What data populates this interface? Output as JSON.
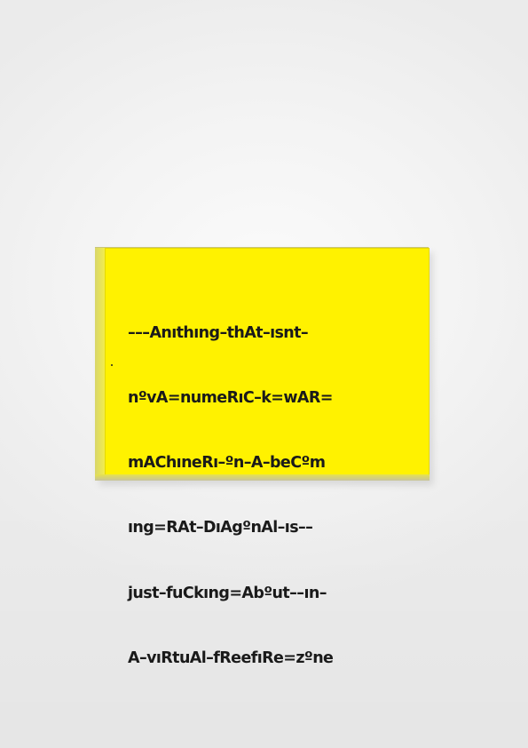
{
  "artwork": {
    "lines": [
      "–––Anıthıng–thAt–ısnt–",
      "nºvA=numeRıC–k=wAR=",
      "mAChıneRı–ºn–A–beCºm",
      "ıng=RAt–DıAgºnAl–ıs––",
      "just–fuCkıng=Abºut––ın–",
      "A–vıRtuAl–fReefıRe=zºne"
    ],
    "colors": {
      "panel": "#fff200",
      "text": "#1a1a1a",
      "wall": "#f3f3f3"
    }
  }
}
